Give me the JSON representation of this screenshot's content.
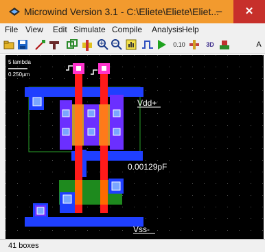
{
  "window": {
    "title": "Microwind Version 3.1 - C:\\Eliete\\Eliete\\Eliet...",
    "min": "–",
    "max": "☐",
    "close": "✕"
  },
  "menu": [
    "File",
    "View",
    "Edit",
    "Simulate",
    "Compile",
    "Analysis",
    "Help"
  ],
  "toolbar": {
    "icons": [
      "open-icon",
      "save-icon",
      "draw-line-icon",
      "connect-icon",
      "via-icon",
      "mos-icon",
      "zoom-in-icon",
      "zoom-out-icon",
      "fit-icon",
      "timing-icon",
      "run-icon",
      "size-icon",
      "measure-icon",
      "3d-icon",
      "process-icon",
      "text-icon"
    ],
    "size_label": "0.10",
    "view3d_label": "3D",
    "partial_label": "A"
  },
  "canvas": {
    "scale_label": "5 lambda",
    "scale_value": "0.250µm",
    "labels": {
      "vdd": "Vdd+",
      "vss": "Vss-",
      "capacitance": "0.00129pF"
    },
    "colors": {
      "metal1": "#1f3fff",
      "poly": "#ff1a1a",
      "nwell_outline": "#2aa22a",
      "pdiff": "#c8962c",
      "ndiff": "#1e8a1e",
      "contact": "#7aa6ff",
      "via_pin": "#ff33cc",
      "grid": "#5a5a5a"
    }
  },
  "status": {
    "text": "41 boxes"
  }
}
